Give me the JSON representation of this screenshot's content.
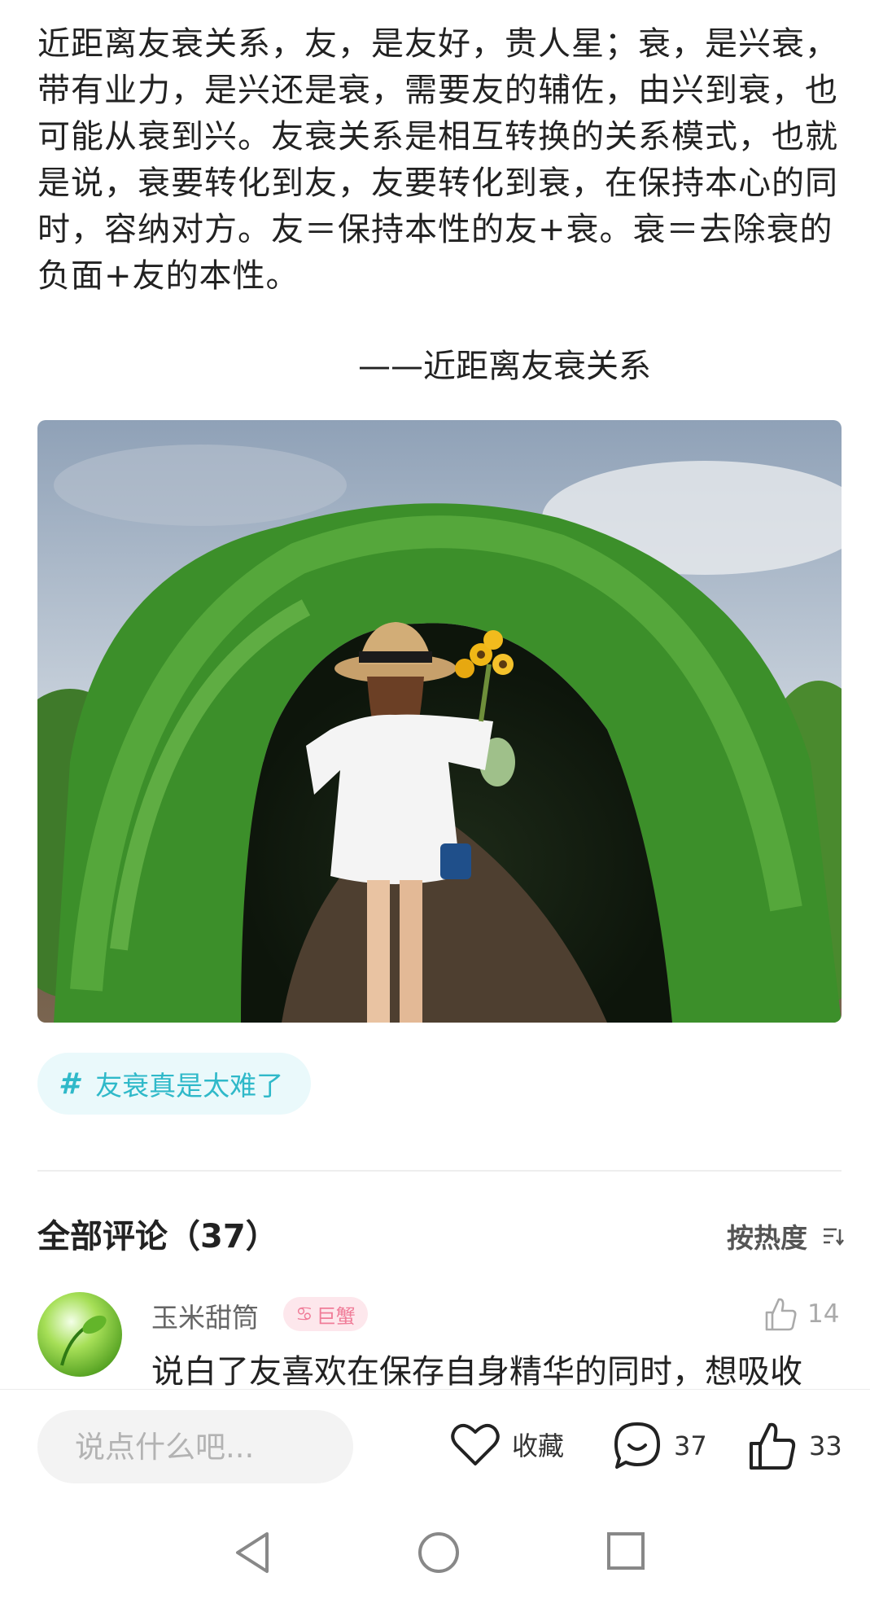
{
  "article": {
    "body": "近距离友衰关系，友，是友好，贵人星；衰，是兴衰，带有业力，是兴还是衰，需要友的辅佐，由兴到衰，也可能从衰到兴。友衰关系是相互转换的关系模式，也就是说，衰要转化到友，友要转化到衰，在保持本心的同时，容纳对方。友＝保持本性的友+衰。衰＝去除衰的负面+友的本性。",
    "quote": "——近距离友衰关系"
  },
  "tag": {
    "hash": "#",
    "label": "友衰真是太难了"
  },
  "comments": {
    "title": "全部评论（37）",
    "sort_label": "按热度",
    "items": [
      {
        "user": "玉米甜筒",
        "zodiac_symbol": "♋",
        "zodiac": "巨蟹",
        "likes": "14",
        "text": "说白了友喜欢在保存自身精华的同时，想吸收"
      }
    ]
  },
  "bottom_bar": {
    "input_placeholder": "说点什么吧...",
    "favorite_label": "收藏",
    "comment_count": "37",
    "like_count": "33"
  },
  "colors": {
    "tag_bg": "#eaf9fb",
    "tag_text": "#2fb9c9",
    "badge_bg": "#fde7ec",
    "badge_text": "#f07c98"
  }
}
